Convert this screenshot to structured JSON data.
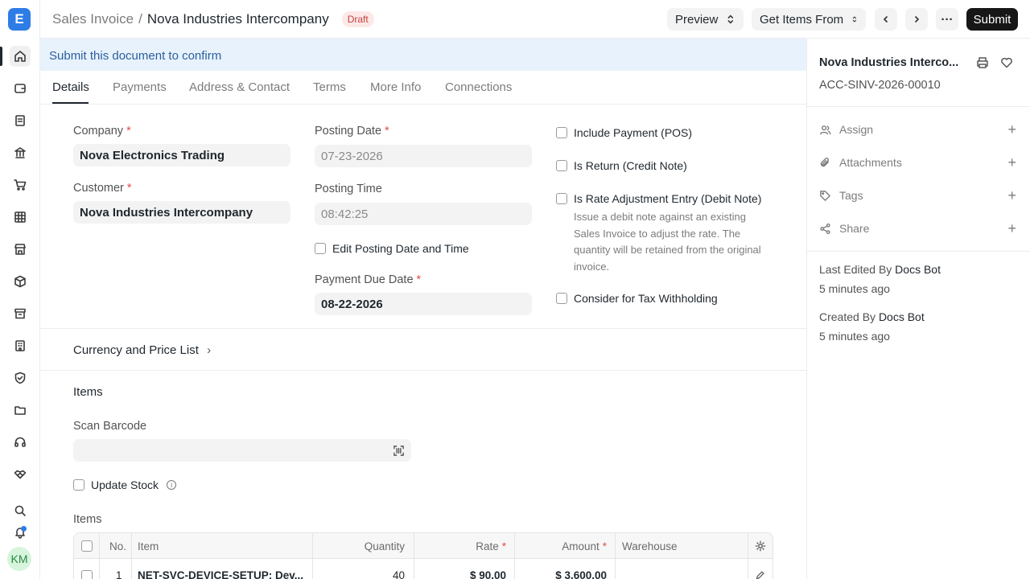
{
  "app": {
    "logo_letter": "E",
    "user_initials": "KM"
  },
  "rail_icons": [
    "home-icon",
    "wallet-icon",
    "document-icon",
    "bank-icon",
    "cart-icon",
    "table-icon",
    "store-icon",
    "package-icon",
    "archive-icon",
    "building-icon",
    "shield-icon",
    "folder-icon",
    "headset-icon",
    "handshake-icon",
    "search-icon",
    "bell-icon"
  ],
  "header": {
    "doctype": "Sales Invoice",
    "separator": "/",
    "title": "Nova Industries Intercompany",
    "status": "Draft",
    "preview_label": "Preview",
    "get_items_label": "Get Items From",
    "more_label": "···",
    "submit_label": "Submit"
  },
  "banner": {
    "text": "Submit this document to confirm"
  },
  "tabs": [
    "Details",
    "Payments",
    "Address & Contact",
    "Terms",
    "More Info",
    "Connections"
  ],
  "form": {
    "company_label": "Company",
    "company_value": "Nova Electronics Trading",
    "customer_label": "Customer",
    "customer_value": "Nova Industries Intercompany",
    "posting_date_label": "Posting Date",
    "posting_date_value": "07-23-2026",
    "posting_time_label": "Posting Time",
    "posting_time_value": "08:42:25",
    "edit_posting_label": "Edit Posting Date and Time",
    "due_date_label": "Payment Due Date",
    "due_date_value": "08-22-2026",
    "required_mark": "*",
    "include_payment_label": "Include Payment (POS)",
    "is_return_label": "Is Return (Credit Note)",
    "rate_adjust_label": "Is Rate Adjustment Entry (Debit Note)",
    "rate_adjust_desc": "Issue a debit note against an existing Sales Invoice to adjust the rate. The quantity will be retained from the original invoice.",
    "tax_withholding_label": "Consider for Tax Withholding"
  },
  "currency_section": {
    "title": "Currency and Price List"
  },
  "items_section": {
    "title": "Items",
    "scan_barcode_label": "Scan Barcode",
    "update_stock_label": "Update Stock",
    "items_label": "Items",
    "columns": {
      "no": "No.",
      "item": "Item",
      "quantity": "Quantity",
      "rate": "Rate",
      "amount": "Amount",
      "warehouse": "Warehouse"
    },
    "rows": [
      {
        "no": "1",
        "item": "NET-SVC-DEVICE-SETUP: Dev...",
        "quantity": "40",
        "rate": "$ 90.00",
        "amount": "$ 3,600.00",
        "warehouse": ""
      }
    ]
  },
  "sidebar": {
    "title": "Nova Industries Interco...",
    "name": "ACC-SINV-2026-00010",
    "actions": [
      {
        "label": "Assign",
        "icon": "user-icon"
      },
      {
        "label": "Attachments",
        "icon": "paperclip-icon"
      },
      {
        "label": "Tags",
        "icon": "tag-icon"
      },
      {
        "label": "Share",
        "icon": "share-icon"
      }
    ],
    "last_edited_prefix": "Last Edited By",
    "last_edited_by": "Docs Bot",
    "last_edited_time": "5 minutes ago",
    "created_prefix": "Created By",
    "created_by": "Docs Bot",
    "created_time": "5 minutes ago"
  }
}
